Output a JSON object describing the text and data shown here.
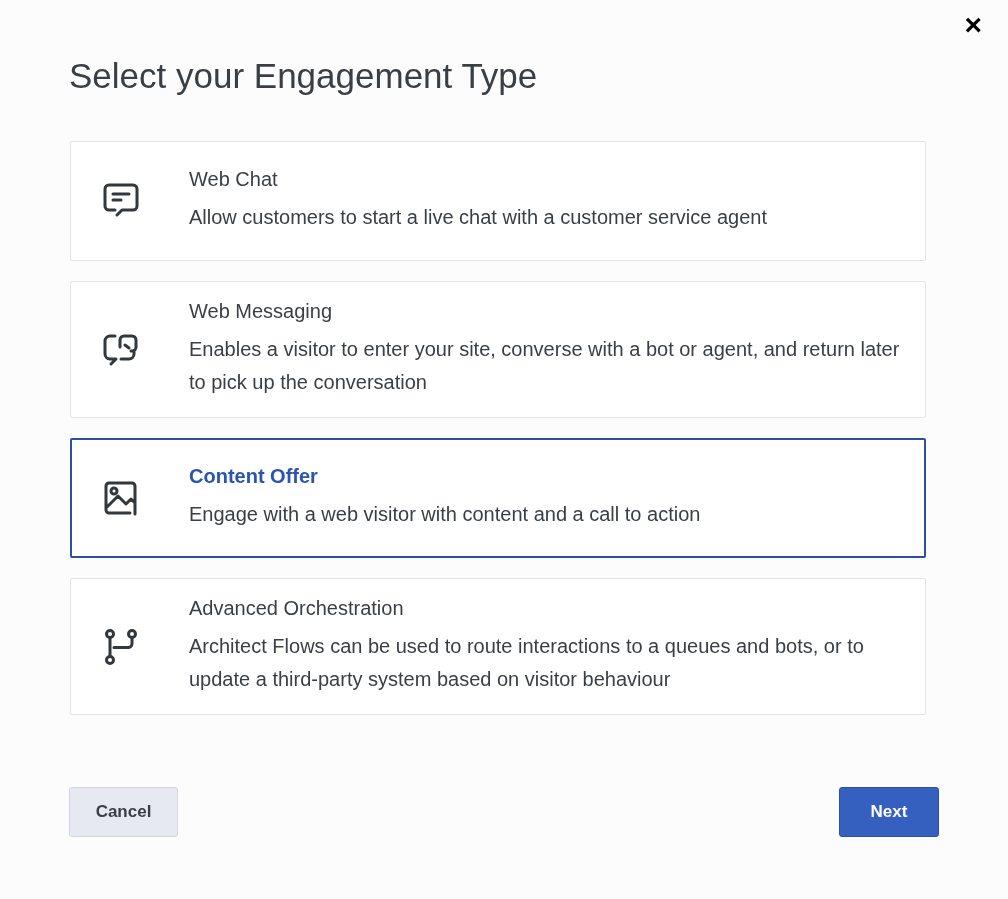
{
  "close": "×",
  "title": "Select your Engagement Type",
  "options": [
    {
      "kind": "chat",
      "name": "Web Chat",
      "description": "Allow customers to start a live chat with a customer service agent",
      "selected": false
    },
    {
      "kind": "messaging",
      "name": "Web Messaging",
      "description": "Enables a visitor to enter your site, converse with a bot or agent, and return later to pick up the conversation",
      "selected": false
    },
    {
      "kind": "image",
      "name": "Content Offer",
      "description": "Engage with a web visitor with content and a call to action",
      "selected": true
    },
    {
      "kind": "branch",
      "name": "Advanced Orchestration",
      "description": "Architect Flows can be used to route interactions to a queues and bots, or to update a third-party system based on visitor behaviour",
      "selected": false
    }
  ],
  "buttons": {
    "cancel": "Cancel",
    "next": "Next"
  }
}
